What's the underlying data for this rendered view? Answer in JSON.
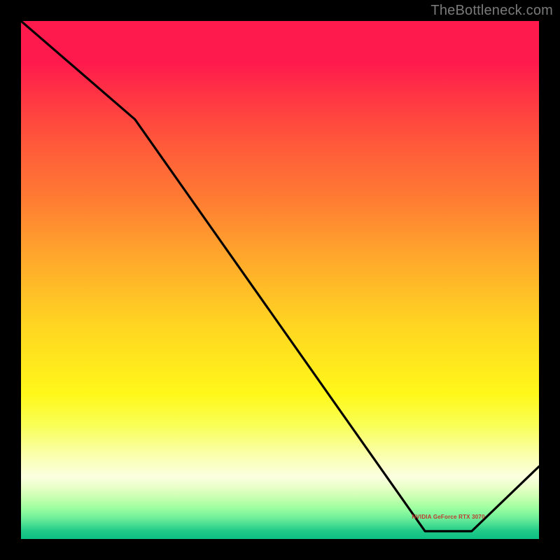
{
  "watermark": "TheBottleneck.com",
  "annotation": "NVIDIA GeForce RTX 3070",
  "chart_data": {
    "type": "line",
    "title": "",
    "xlabel": "",
    "ylabel": "",
    "xlim": [
      0,
      100
    ],
    "ylim": [
      0,
      100
    ],
    "x": [
      0,
      22,
      78,
      87,
      100
    ],
    "values": [
      100,
      81,
      1.5,
      1.5,
      14
    ],
    "annotation_x_range": [
      76,
      89
    ],
    "annotation_y": 4
  },
  "colors": {
    "curve": "#000000",
    "background_top": "#ff1a4d",
    "background_bottom": "#0cc084",
    "watermark": "#7a7a7a",
    "annotation": "#c0392b"
  }
}
